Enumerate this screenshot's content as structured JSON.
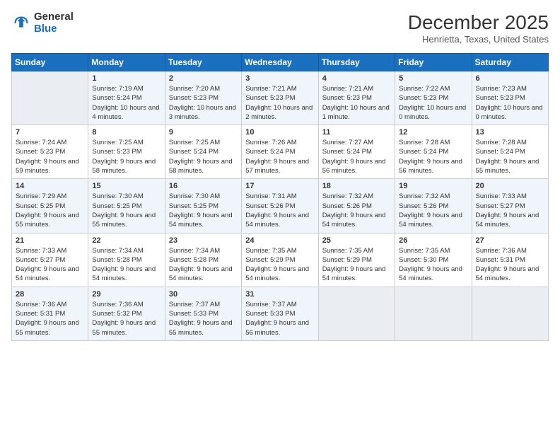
{
  "header": {
    "logo_general": "General",
    "logo_blue": "Blue",
    "month_title": "December 2025",
    "location": "Henrietta, Texas, United States"
  },
  "weekdays": [
    "Sunday",
    "Monday",
    "Tuesday",
    "Wednesday",
    "Thursday",
    "Friday",
    "Saturday"
  ],
  "weeks": [
    [
      {
        "day": "",
        "sunrise": "",
        "sunset": "",
        "daylight": ""
      },
      {
        "day": "1",
        "sunrise": "Sunrise: 7:19 AM",
        "sunset": "Sunset: 5:24 PM",
        "daylight": "Daylight: 10 hours and 4 minutes."
      },
      {
        "day": "2",
        "sunrise": "Sunrise: 7:20 AM",
        "sunset": "Sunset: 5:23 PM",
        "daylight": "Daylight: 10 hours and 3 minutes."
      },
      {
        "day": "3",
        "sunrise": "Sunrise: 7:21 AM",
        "sunset": "Sunset: 5:23 PM",
        "daylight": "Daylight: 10 hours and 2 minutes."
      },
      {
        "day": "4",
        "sunrise": "Sunrise: 7:21 AM",
        "sunset": "Sunset: 5:23 PM",
        "daylight": "Daylight: 10 hours and 1 minute."
      },
      {
        "day": "5",
        "sunrise": "Sunrise: 7:22 AM",
        "sunset": "Sunset: 5:23 PM",
        "daylight": "Daylight: 10 hours and 0 minutes."
      },
      {
        "day": "6",
        "sunrise": "Sunrise: 7:23 AM",
        "sunset": "Sunset: 5:23 PM",
        "daylight": "Daylight: 10 hours and 0 minutes."
      }
    ],
    [
      {
        "day": "7",
        "sunrise": "Sunrise: 7:24 AM",
        "sunset": "Sunset: 5:23 PM",
        "daylight": "Daylight: 9 hours and 59 minutes."
      },
      {
        "day": "8",
        "sunrise": "Sunrise: 7:25 AM",
        "sunset": "Sunset: 5:23 PM",
        "daylight": "Daylight: 9 hours and 58 minutes."
      },
      {
        "day": "9",
        "sunrise": "Sunrise: 7:25 AM",
        "sunset": "Sunset: 5:24 PM",
        "daylight": "Daylight: 9 hours and 58 minutes."
      },
      {
        "day": "10",
        "sunrise": "Sunrise: 7:26 AM",
        "sunset": "Sunset: 5:24 PM",
        "daylight": "Daylight: 9 hours and 57 minutes."
      },
      {
        "day": "11",
        "sunrise": "Sunrise: 7:27 AM",
        "sunset": "Sunset: 5:24 PM",
        "daylight": "Daylight: 9 hours and 56 minutes."
      },
      {
        "day": "12",
        "sunrise": "Sunrise: 7:28 AM",
        "sunset": "Sunset: 5:24 PM",
        "daylight": "Daylight: 9 hours and 56 minutes."
      },
      {
        "day": "13",
        "sunrise": "Sunrise: 7:28 AM",
        "sunset": "Sunset: 5:24 PM",
        "daylight": "Daylight: 9 hours and 55 minutes."
      }
    ],
    [
      {
        "day": "14",
        "sunrise": "Sunrise: 7:29 AM",
        "sunset": "Sunset: 5:25 PM",
        "daylight": "Daylight: 9 hours and 55 minutes."
      },
      {
        "day": "15",
        "sunrise": "Sunrise: 7:30 AM",
        "sunset": "Sunset: 5:25 PM",
        "daylight": "Daylight: 9 hours and 55 minutes."
      },
      {
        "day": "16",
        "sunrise": "Sunrise: 7:30 AM",
        "sunset": "Sunset: 5:25 PM",
        "daylight": "Daylight: 9 hours and 54 minutes."
      },
      {
        "day": "17",
        "sunrise": "Sunrise: 7:31 AM",
        "sunset": "Sunset: 5:26 PM",
        "daylight": "Daylight: 9 hours and 54 minutes."
      },
      {
        "day": "18",
        "sunrise": "Sunrise: 7:32 AM",
        "sunset": "Sunset: 5:26 PM",
        "daylight": "Daylight: 9 hours and 54 minutes."
      },
      {
        "day": "19",
        "sunrise": "Sunrise: 7:32 AM",
        "sunset": "Sunset: 5:26 PM",
        "daylight": "Daylight: 9 hours and 54 minutes."
      },
      {
        "day": "20",
        "sunrise": "Sunrise: 7:33 AM",
        "sunset": "Sunset: 5:27 PM",
        "daylight": "Daylight: 9 hours and 54 minutes."
      }
    ],
    [
      {
        "day": "21",
        "sunrise": "Sunrise: 7:33 AM",
        "sunset": "Sunset: 5:27 PM",
        "daylight": "Daylight: 9 hours and 54 minutes."
      },
      {
        "day": "22",
        "sunrise": "Sunrise: 7:34 AM",
        "sunset": "Sunset: 5:28 PM",
        "daylight": "Daylight: 9 hours and 54 minutes."
      },
      {
        "day": "23",
        "sunrise": "Sunrise: 7:34 AM",
        "sunset": "Sunset: 5:28 PM",
        "daylight": "Daylight: 9 hours and 54 minutes."
      },
      {
        "day": "24",
        "sunrise": "Sunrise: 7:35 AM",
        "sunset": "Sunset: 5:29 PM",
        "daylight": "Daylight: 9 hours and 54 minutes."
      },
      {
        "day": "25",
        "sunrise": "Sunrise: 7:35 AM",
        "sunset": "Sunset: 5:29 PM",
        "daylight": "Daylight: 9 hours and 54 minutes."
      },
      {
        "day": "26",
        "sunrise": "Sunrise: 7:35 AM",
        "sunset": "Sunset: 5:30 PM",
        "daylight": "Daylight: 9 hours and 54 minutes."
      },
      {
        "day": "27",
        "sunrise": "Sunrise: 7:36 AM",
        "sunset": "Sunset: 5:31 PM",
        "daylight": "Daylight: 9 hours and 54 minutes."
      }
    ],
    [
      {
        "day": "28",
        "sunrise": "Sunrise: 7:36 AM",
        "sunset": "Sunset: 5:31 PM",
        "daylight": "Daylight: 9 hours and 55 minutes."
      },
      {
        "day": "29",
        "sunrise": "Sunrise: 7:36 AM",
        "sunset": "Sunset: 5:32 PM",
        "daylight": "Daylight: 9 hours and 55 minutes."
      },
      {
        "day": "30",
        "sunrise": "Sunrise: 7:37 AM",
        "sunset": "Sunset: 5:33 PM",
        "daylight": "Daylight: 9 hours and 55 minutes."
      },
      {
        "day": "31",
        "sunrise": "Sunrise: 7:37 AM",
        "sunset": "Sunset: 5:33 PM",
        "daylight": "Daylight: 9 hours and 56 minutes."
      },
      {
        "day": "",
        "sunrise": "",
        "sunset": "",
        "daylight": ""
      },
      {
        "day": "",
        "sunrise": "",
        "sunset": "",
        "daylight": ""
      },
      {
        "day": "",
        "sunrise": "",
        "sunset": "",
        "daylight": ""
      }
    ]
  ]
}
